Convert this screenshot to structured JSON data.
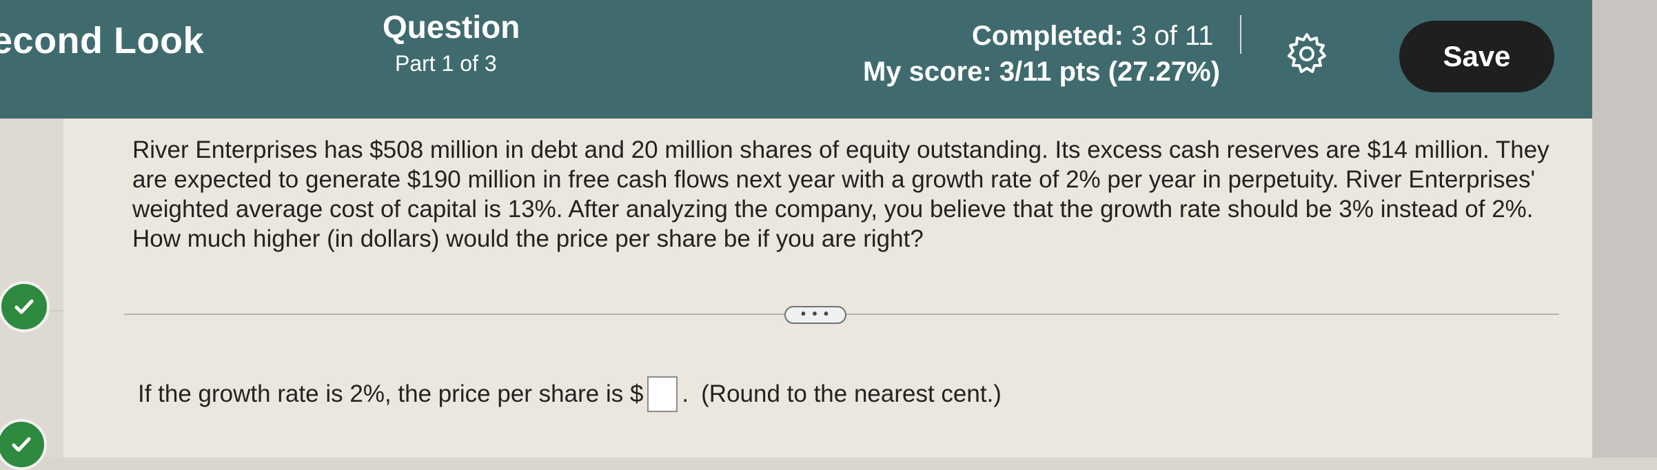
{
  "header": {
    "app_title": "econd Look",
    "question_title": "Question",
    "question_part": "Part 1 of 3",
    "completed_label": "Completed:",
    "completed_count": "3 of 11",
    "score": "My score: 3/11 pts (27.27%)",
    "settings_icon": "gear-icon",
    "save_label": "Save",
    "background_color": "#3f6a6e"
  },
  "sidebar": {
    "items": [
      {
        "status": "correct",
        "icon": "checkmark-icon",
        "color": "#2e8a3e"
      },
      {
        "status": "correct",
        "icon": "checkmark-icon",
        "color": "#2e8a3e"
      }
    ]
  },
  "question": {
    "text": "River Enterprises has $508 million in debt and 20 million shares of equity outstanding. Its excess cash reserves are $14 million. They are expected to generate $190 million in free cash flows next year with a growth rate of 2% per year in perpetuity. River Enterprises' weighted average cost of capital is 13%. After analyzing the company, you believe that the growth rate should be 3% instead of 2%. How much higher (in dollars) would the price per share be if you are right?",
    "more_label": "• • •"
  },
  "answer": {
    "prefix": "If the growth rate is 2%, the price per share is $",
    "suffix": ".",
    "note": "(Round to the nearest cent.)",
    "value": ""
  }
}
